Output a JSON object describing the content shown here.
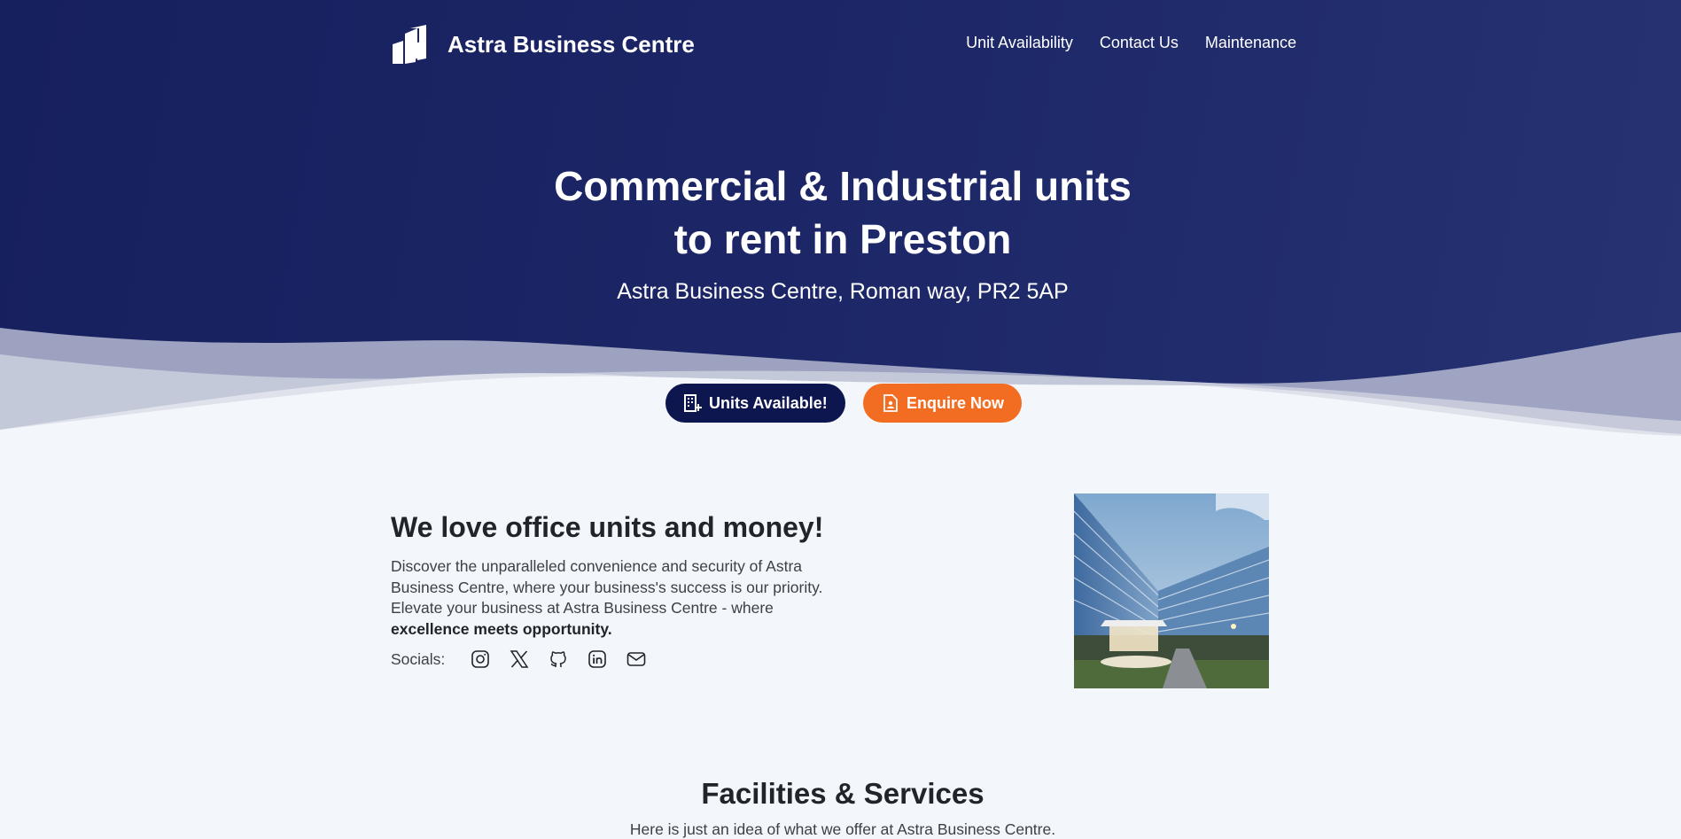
{
  "brand": {
    "name": "Astra Business Centre"
  },
  "nav": {
    "items": [
      {
        "label": "Unit Availability"
      },
      {
        "label": "Contact Us"
      },
      {
        "label": "Maintenance"
      }
    ]
  },
  "hero": {
    "title_line1": "Commercial & Industrial units",
    "title_line2": "to rent in Preston",
    "subtitle": "Astra Business Centre, Roman way, PR2 5AP",
    "units_button": "Units Available!",
    "enquire_button": "Enquire Now"
  },
  "about": {
    "heading": "We love office units and money!",
    "body": "Discover the unparalleled convenience and security of Astra Business Centre, where your business's success is our priority. Elevate your business at Astra Business Centre - where",
    "body_bold": "excellence meets opportunity.",
    "socials_label": "Socials:",
    "social_icons": [
      "instagram-icon",
      "x-twitter-icon",
      "github-icon",
      "linkedin-icon",
      "email-icon"
    ]
  },
  "facilities": {
    "heading": "Facilities & Services",
    "subtitle": "Here is just an idea of what we offer at Astra Business Centre."
  },
  "colors": {
    "hero_bg": "#1c2666",
    "units_button": "#0e1650",
    "enquire_button": "#f26d22",
    "page_bg": "#f3f6fa"
  }
}
